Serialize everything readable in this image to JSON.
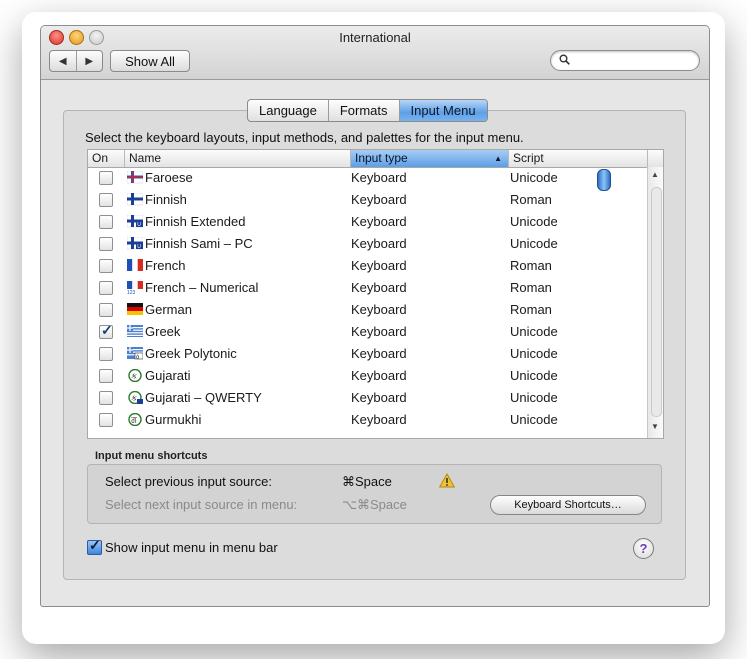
{
  "window": {
    "title": "International"
  },
  "toolbar": {
    "back_label": "◀",
    "forward_label": "▶",
    "show_all_label": "Show All",
    "search_placeholder": ""
  },
  "tabs": [
    {
      "label": "Language"
    },
    {
      "label": "Formats"
    },
    {
      "label": "Input Menu",
      "active": true
    }
  ],
  "instructions": "Select the keyboard layouts, input methods, and palettes for the input menu.",
  "table": {
    "headers": {
      "on": "On",
      "name": "Name",
      "input_type": "Input type",
      "script": "Script"
    },
    "sort_indicator": "▲",
    "rows": [
      {
        "checked": false,
        "flag": "faroese",
        "name": "Faroese",
        "type": "Keyboard",
        "script": "Unicode"
      },
      {
        "checked": false,
        "flag": "finnish",
        "name": "Finnish",
        "type": "Keyboard",
        "script": "Roman"
      },
      {
        "checked": false,
        "flag": "finnish-ext",
        "name": "Finnish Extended",
        "type": "Keyboard",
        "script": "Unicode"
      },
      {
        "checked": false,
        "flag": "finnish-sami",
        "name": "Finnish Sami – PC",
        "type": "Keyboard",
        "script": "Unicode"
      },
      {
        "checked": false,
        "flag": "french",
        "name": "French",
        "type": "Keyboard",
        "script": "Roman"
      },
      {
        "checked": false,
        "flag": "french-num",
        "name": "French – Numerical",
        "type": "Keyboard",
        "script": "Roman"
      },
      {
        "checked": false,
        "flag": "german",
        "name": "German",
        "type": "Keyboard",
        "script": "Roman"
      },
      {
        "checked": true,
        "flag": "greek",
        "name": "Greek",
        "type": "Keyboard",
        "script": "Unicode"
      },
      {
        "checked": false,
        "flag": "greek-poly",
        "name": "Greek Polytonic",
        "type": "Keyboard",
        "script": "Unicode"
      },
      {
        "checked": false,
        "flag": "gujarati",
        "name": "Gujarati",
        "type": "Keyboard",
        "script": "Unicode"
      },
      {
        "checked": false,
        "flag": "gujarati-qwerty",
        "name": "Gujarati – QWERTY",
        "type": "Keyboard",
        "script": "Unicode"
      },
      {
        "checked": false,
        "flag": "gurmukhi",
        "name": "Gurmukhi",
        "type": "Keyboard",
        "script": "Unicode"
      }
    ]
  },
  "shortcuts": {
    "title": "Input menu shortcuts",
    "prev_label": "Select previous input source:",
    "prev_key": "⌘Space",
    "next_label": "Select next input source in menu:",
    "next_key": "⌥⌘Space",
    "button_label": "Keyboard Shortcuts…"
  },
  "show_in_menu_bar": {
    "label": "Show input menu in menu bar",
    "checked": true
  },
  "help_label": "?",
  "colors": {
    "accent": "#5fa0e6",
    "warning": "#f1c232"
  }
}
